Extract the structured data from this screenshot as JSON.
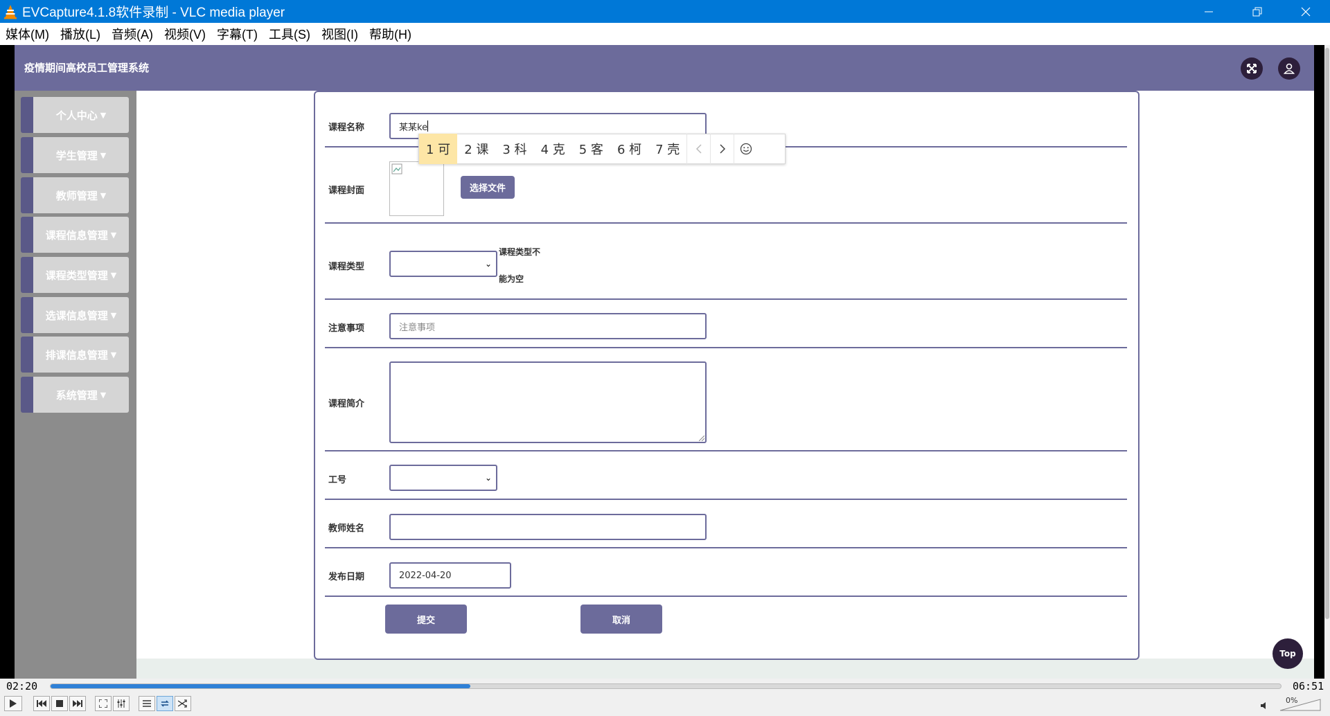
{
  "window": {
    "title": "EVCapture4.1.8软件录制 - VLC media player",
    "colors": {
      "titlebar": "#0078d7"
    }
  },
  "menu": [
    "媒体(M)",
    "播放(L)",
    "音频(A)",
    "视频(V)",
    "字幕(T)",
    "工具(S)",
    "视图(I)",
    "帮助(H)"
  ],
  "site": {
    "title": "疫情期间高校员工管理系统",
    "accent": "#6c6b9b",
    "dark": "#2d1f3b"
  },
  "sidebar": [
    {
      "label": "个人中心"
    },
    {
      "label": "学生管理"
    },
    {
      "label": "教师管理"
    },
    {
      "label": "课程信息管理"
    },
    {
      "label": "课程类型管理"
    },
    {
      "label": "选课信息管理"
    },
    {
      "label": "排课信息管理"
    },
    {
      "label": "系统管理"
    }
  ],
  "form": {
    "course_name_label": "课程名称",
    "course_name_value": "某某ke",
    "cover_label": "课程封面",
    "choose_file": "选择文件",
    "type_label": "课程类型",
    "type_error_line1": "课程类型不",
    "type_error_line2": "能为空",
    "notes_label": "注意事项",
    "notes_placeholder": "注意事项",
    "intro_label": "课程简介",
    "staff_id_label": "工号",
    "teacher_name_label": "教师姓名",
    "publish_date_label": "发布日期",
    "publish_date_value": "2022-04-20",
    "submit": "提交",
    "cancel": "取消"
  },
  "ime": {
    "candidates": [
      "1 可",
      "2 课",
      "3 科",
      "4 克",
      "5 客",
      "6 柯",
      "7 壳"
    ],
    "active_index": 0
  },
  "top_button": "Top",
  "player": {
    "elapsed": "02:20",
    "total": "06:51",
    "progress": 0.341,
    "volume": "0%",
    "seek_color": "#2f80d6"
  }
}
